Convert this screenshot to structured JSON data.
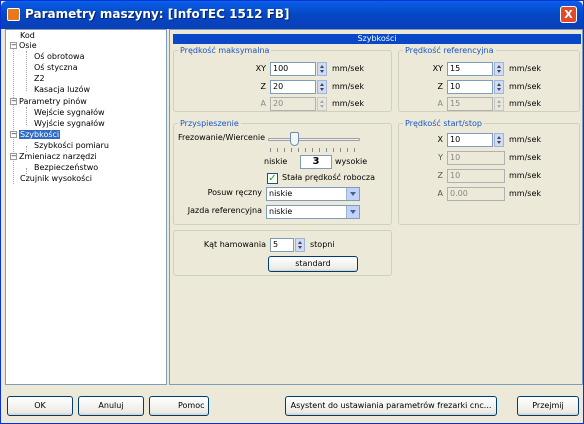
{
  "window": {
    "title": "Parametry maszyny: [InfoTEC 1512 FB]",
    "close_label": "X"
  },
  "tree": {
    "items": [
      "Kod",
      "Osie",
      "Oś obrotowa",
      "Oś styczna",
      "Z2",
      "Kasacja luzów",
      "Parametry pinów",
      "Wejście sygnałów",
      "Wyjście sygnałów",
      "Szybkości",
      "Szybkości pomiaru",
      "Zmieniacz narzędzi",
      "Bezpieczeństwo",
      "Czujnik wysokości"
    ],
    "expander": "−"
  },
  "panel": {
    "title": "Szybkości"
  },
  "max_speed": {
    "title": "Prędkość maksymalna",
    "rows": [
      {
        "axis": "XY",
        "value": "100",
        "unit": "mm/sek"
      },
      {
        "axis": "Z",
        "value": "20",
        "unit": "mm/sek"
      },
      {
        "axis": "A",
        "value": "20",
        "unit": "mm/sek"
      }
    ]
  },
  "ref_speed": {
    "title": "Prędkość referencyjna",
    "rows": [
      {
        "axis": "XY",
        "value": "15",
        "unit": "mm/sek"
      },
      {
        "axis": "Z",
        "value": "10",
        "unit": "mm/sek"
      },
      {
        "axis": "A",
        "value": "15",
        "unit": "mm/sek"
      }
    ]
  },
  "acceleration": {
    "title": "Przyspieszenie",
    "slider_label": "Frezowanie/Wiercenie",
    "low_label": "niskie",
    "value": "3",
    "high_label": "wysokie",
    "slider_level": 0.3,
    "checkbox_label": "Stała prędkość robocza",
    "checkbox_mark": "✓",
    "posuw_label": "Posuw ręczny",
    "posuw_value": "niskie",
    "jazda_label": "Jazda referencyjna",
    "jazda_value": "niskie"
  },
  "startstop": {
    "title": "Prędkość start/stop",
    "rows": [
      {
        "axis": "X",
        "value": "10",
        "unit": "mm/sek"
      },
      {
        "axis": "Y",
        "value": "10",
        "unit": "mm/sek"
      },
      {
        "axis": "Z",
        "value": "10",
        "unit": "mm/sek"
      },
      {
        "axis": "A",
        "value": "0.00",
        "unit": "mm/sek"
      }
    ]
  },
  "braking": {
    "label": "Kąt hamowania",
    "value": "5",
    "unit": "stopni",
    "button": "standard"
  },
  "buttons": {
    "ok": "OK",
    "cancel": "Anuluj",
    "help": "Pomoc",
    "assistant": "Asystent do ustawiania parametrów frezarki cnc...",
    "apply": "Przejmij"
  }
}
